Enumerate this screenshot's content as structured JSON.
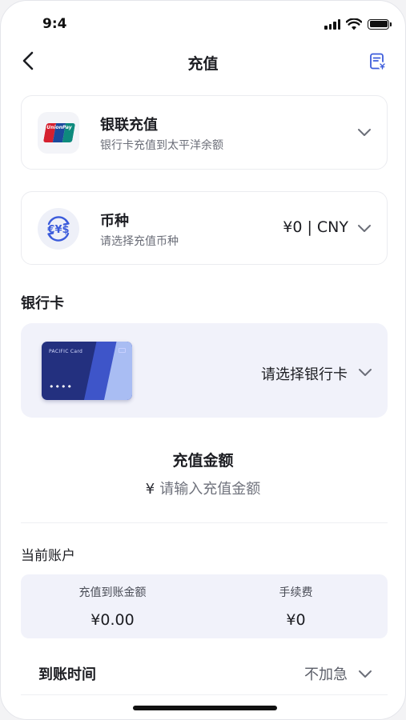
{
  "status_bar": {
    "time": "9:4"
  },
  "nav": {
    "title": "充值",
    "back_icon": "chevron-left-icon",
    "record_icon": "receipt-icon"
  },
  "payment_method": {
    "logo_text": "UnionPay",
    "title": "银联充值",
    "subtitle": "银行卡充值到太平洋余额"
  },
  "currency": {
    "title": "币种",
    "subtitle": "请选择充值币种",
    "value": "¥0 | CNY"
  },
  "bank_card": {
    "section_label": "银行卡",
    "card_brand": "PACIFIC Card",
    "card_number_masked": "••••",
    "placeholder": "请选择银行卡"
  },
  "amount": {
    "title": "充值金额",
    "currency_symbol": "¥",
    "placeholder": "请输入充值金额"
  },
  "account": {
    "section_label": "当前账户",
    "credited_label": "充值到账金额",
    "credited_value": "¥0.00",
    "fee_label": "手续费",
    "fee_value": "¥0"
  },
  "arrival": {
    "label": "到账时间",
    "value": "不加急"
  },
  "colors": {
    "accent": "#3b5bdb",
    "panel_bg": "#f1f2fa",
    "card_dark": "#23307f"
  }
}
